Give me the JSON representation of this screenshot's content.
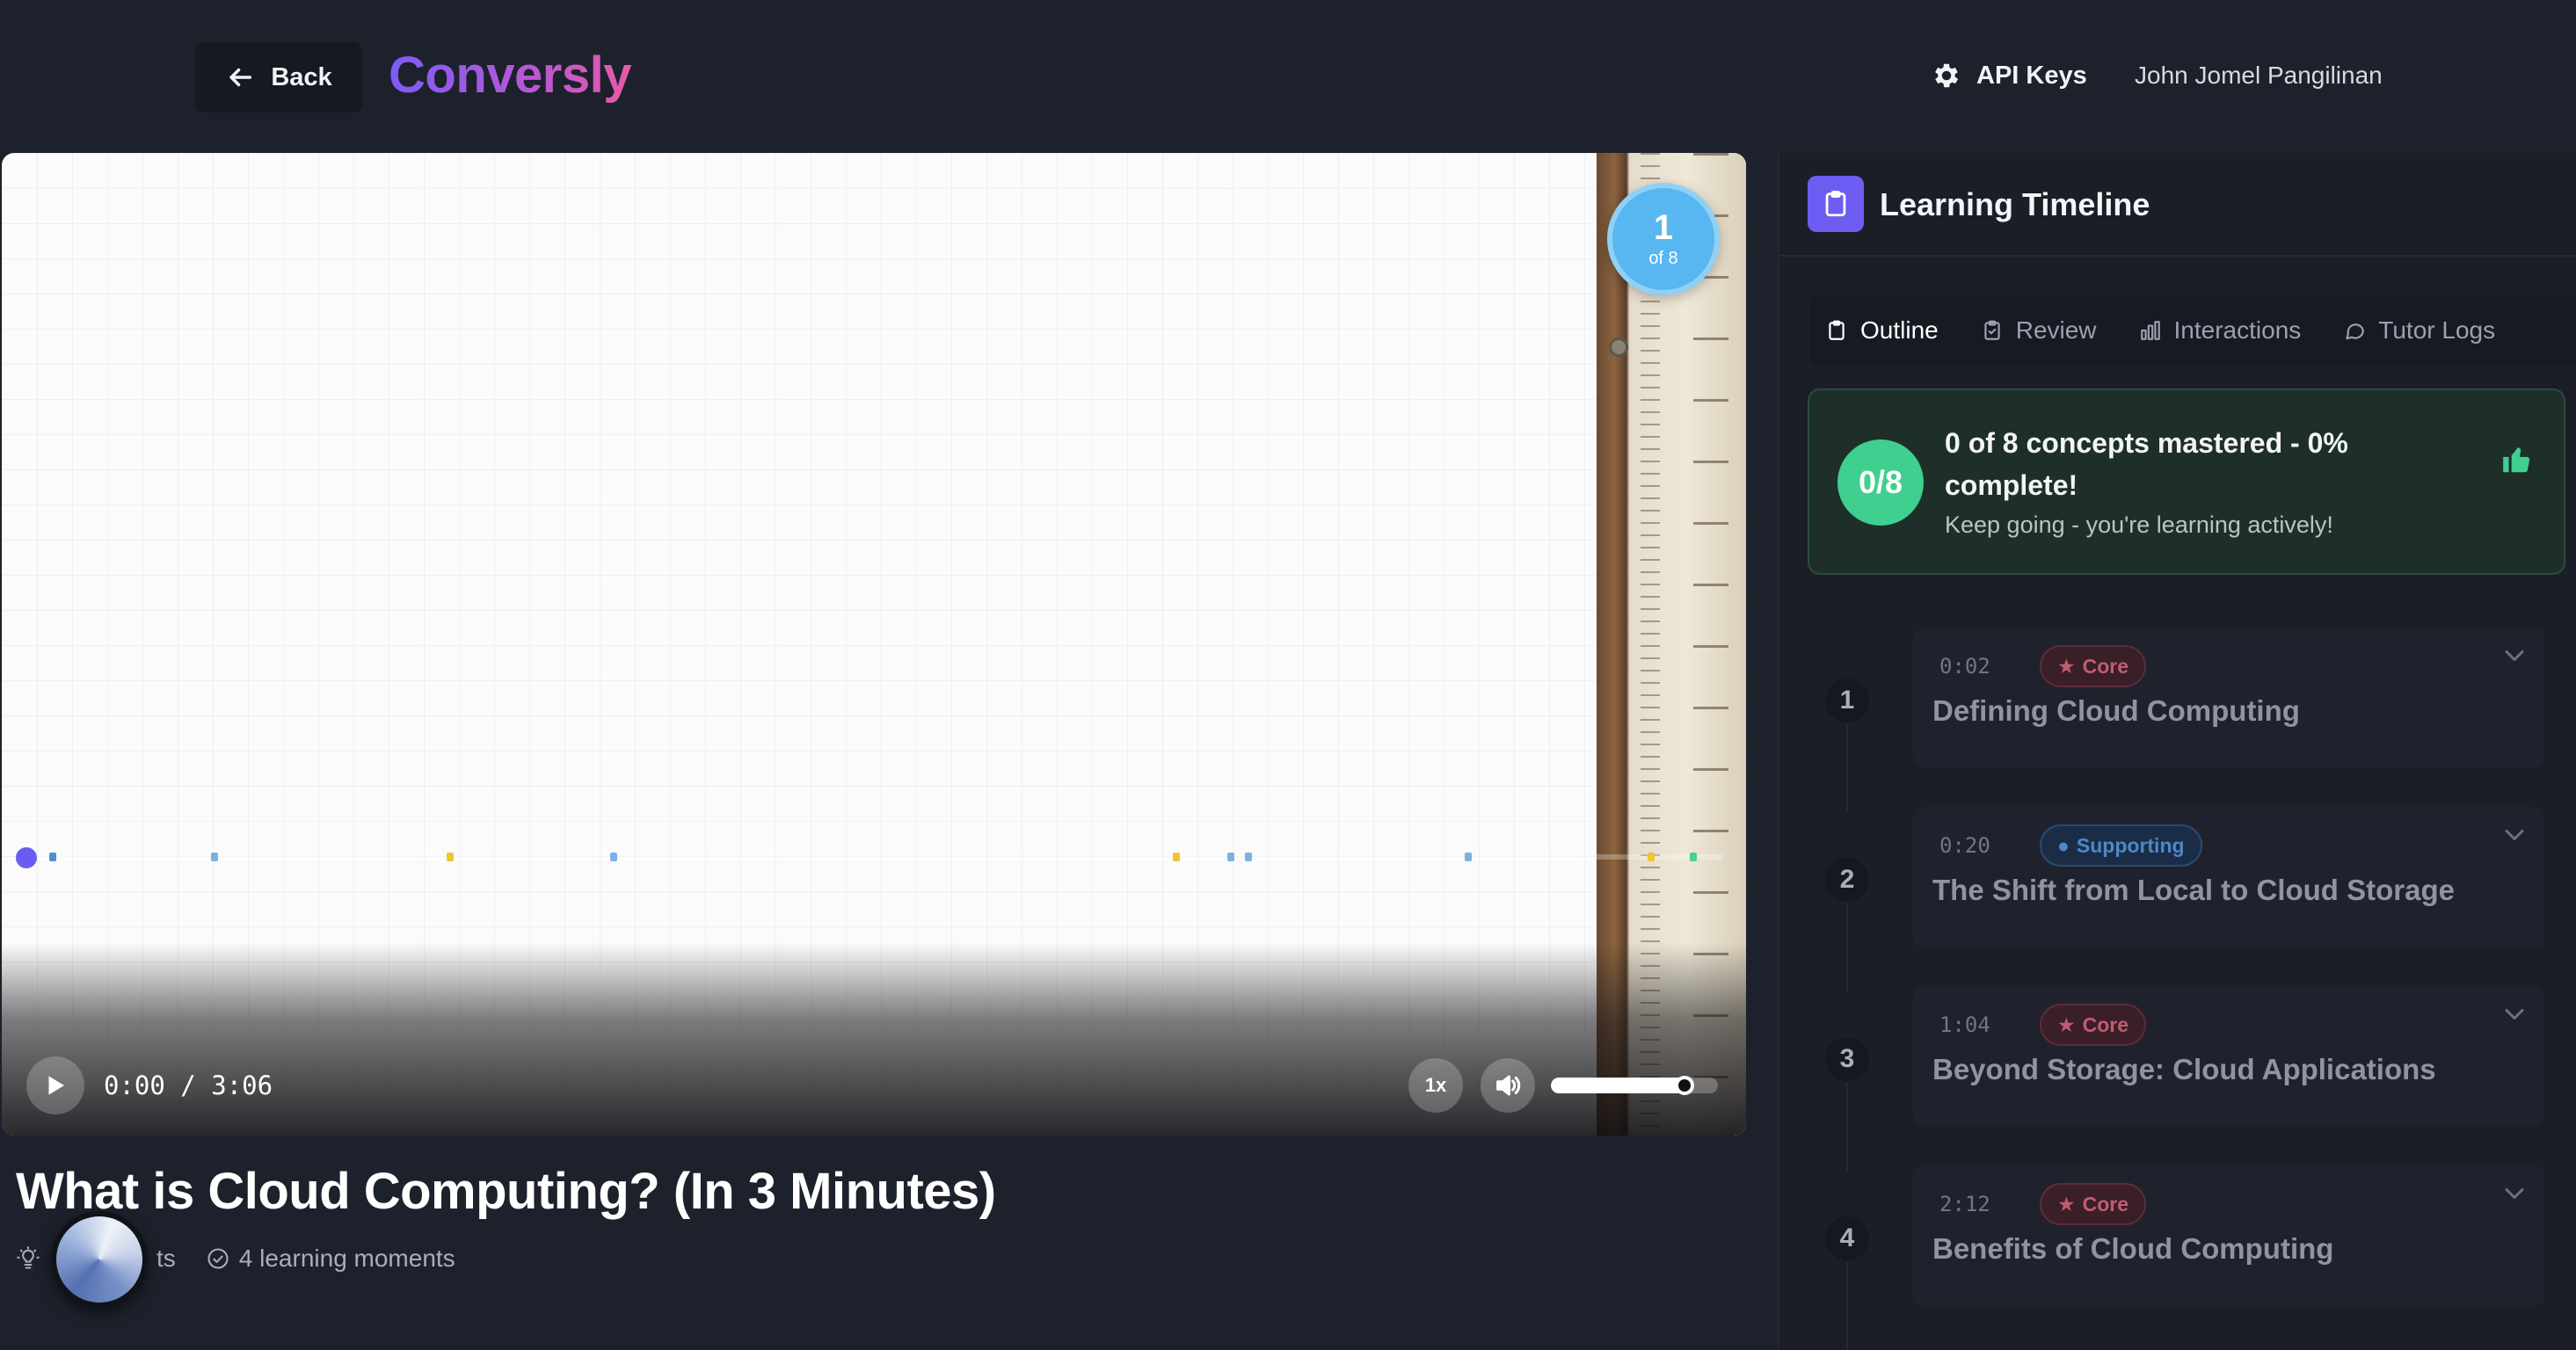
{
  "header": {
    "back_label": "Back",
    "brand": "Conversly",
    "api_keys_label": "API Keys",
    "user_name": "John Jomel Pangilinan"
  },
  "player": {
    "badge_number": "1",
    "badge_of": "of 8",
    "time_display": "0:00 / 3:06",
    "speed_label": "1x",
    "progress_fraction": 0,
    "volume_fraction": 0.8,
    "marker_colors": [
      "#4a90d9",
      "#f2c230",
      "#4ccf8c"
    ]
  },
  "video_info": {
    "title": "What is Cloud Computing? (In 3 Minutes)",
    "meta_partial": "ts",
    "moments_label": "4 learning moments"
  },
  "panel": {
    "title": "Learning Timeline",
    "tabs": [
      {
        "label": "Outline",
        "icon": "clipboard-icon",
        "active": true
      },
      {
        "label": "Review",
        "icon": "clipboard-check-icon",
        "active": false
      },
      {
        "label": "Interactions",
        "icon": "bar-chart-icon",
        "active": false
      },
      {
        "label": "Tutor Logs",
        "icon": "chat-bubble-icon",
        "active": false
      }
    ],
    "summary": {
      "score": "0/8",
      "title": "0 of 8 concepts mastered - 0% complete!",
      "subtitle": "Keep going - you're learning actively!"
    },
    "concepts": [
      {
        "number": "1",
        "time": "0:02",
        "tag": "Core",
        "tag_type": "core",
        "title": "Defining Cloud Computing"
      },
      {
        "number": "2",
        "time": "0:20",
        "tag": "Supporting",
        "tag_type": "supporting",
        "title": "The Shift from Local to Cloud Storage"
      },
      {
        "number": "3",
        "time": "1:04",
        "tag": "Core",
        "tag_type": "core",
        "title": "Beyond Storage: Cloud Applications"
      },
      {
        "number": "4",
        "time": "2:12",
        "tag": "Core",
        "tag_type": "core",
        "title": "Benefits of Cloud Computing"
      }
    ]
  },
  "colors": {
    "accent": "#6d5df3",
    "success": "#3fcf8e",
    "core_tag": "#c25b72",
    "supporting_tag": "#4d88c8"
  }
}
